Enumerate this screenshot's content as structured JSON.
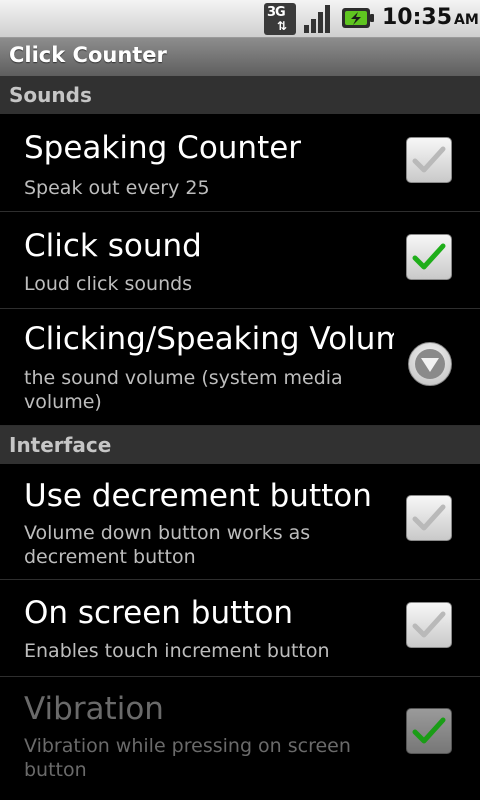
{
  "status_bar": {
    "network": "3G",
    "network_arrows": "⇅",
    "time": "10:35",
    "ampm": "AM"
  },
  "title_bar": {
    "title": "Click Counter"
  },
  "categories": [
    {
      "label": "Sounds"
    },
    {
      "label": "Interface"
    }
  ],
  "preferences": [
    {
      "title": "Speaking Counter",
      "summary": "Speak out every 25",
      "checked": false,
      "enabled": true
    },
    {
      "title": "Click sound",
      "summary": "Loud click sounds",
      "checked": true,
      "enabled": true
    },
    {
      "title": "Clicking/Speaking Volume",
      "summary": "the sound volume (system media volume)",
      "enabled": true
    },
    {
      "title": "Use decrement button",
      "summary": "Volume down button works as decrement button",
      "checked": false,
      "enabled": true
    },
    {
      "title": "On screen button",
      "summary": "Enables touch increment button",
      "checked": false,
      "enabled": true
    },
    {
      "title": "Vibration",
      "summary": "Vibration while pressing on screen button",
      "checked": true,
      "enabled": false
    }
  ],
  "colors": {
    "check_green": "#1fae1a",
    "check_gray": "#b9b9b9",
    "battery_green": "#5fc520"
  },
  "icons": {
    "network": "3g-data-icon",
    "signal": "signal-strength-icon",
    "battery": "battery-charging-icon",
    "dropdown": "dropdown-arrow-icon"
  }
}
